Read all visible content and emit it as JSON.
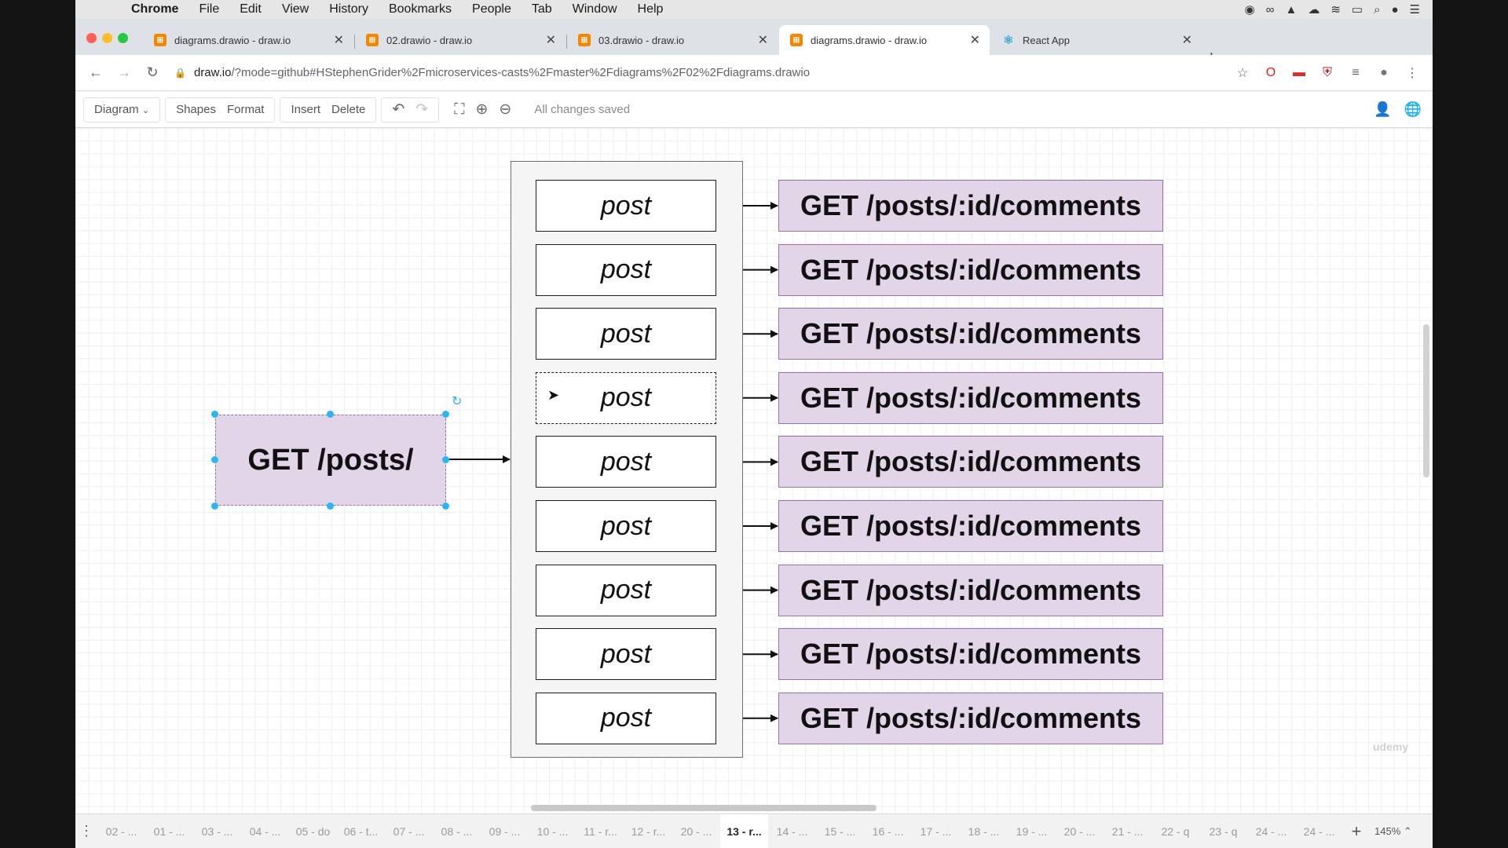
{
  "menubar": {
    "app": "Chrome",
    "items": [
      "File",
      "Edit",
      "View",
      "History",
      "Bookmarks",
      "People",
      "Tab",
      "Window",
      "Help"
    ]
  },
  "tabs": [
    {
      "title": "diagrams.drawio - draw.io",
      "active": false
    },
    {
      "title": "02.drawio - draw.io",
      "active": false
    },
    {
      "title": "03.drawio - draw.io",
      "active": false
    },
    {
      "title": "diagrams.drawio - draw.io",
      "active": true
    },
    {
      "title": "React App",
      "active": false
    }
  ],
  "address": {
    "host": "draw.io",
    "path": "/?mode=github#HStephenGrider%2Fmicroservices-casts%2Fmaster%2Fdiagrams%2F02%2Fdiagrams.drawio"
  },
  "toolbar": {
    "diagram": "Diagram",
    "shapes": "Shapes",
    "format": "Format",
    "insert": "Insert",
    "delete": "Delete",
    "status": "All changes saved"
  },
  "canvas": {
    "source_label": "GET /posts/",
    "post_label": "post",
    "request_label": "GET /posts/:id/comments",
    "row_count": 9
  },
  "pages": [
    "02 - ...",
    "01 - ...",
    "03 - ...",
    "04 - ...",
    "05 - do",
    "06 - t...",
    "07 - ...",
    "08 - ...",
    "09 - ...",
    "10 - ...",
    "11 - r...",
    "12 - r...",
    "20 - ...",
    "13 - r...",
    "14 - ...",
    "15 - ...",
    "16 - ...",
    "17 - ...",
    "18 - ...",
    "19 - ...",
    "20 - ...",
    "21 - ...",
    "22 - q",
    "23 - q",
    "24 - ...",
    "24 - ..."
  ],
  "active_page_index": 13,
  "zoom": "145%",
  "colors": {
    "request_fill": "#e1d5e7",
    "request_stroke": "#9673a6",
    "selection_handle": "#29b6f2"
  }
}
